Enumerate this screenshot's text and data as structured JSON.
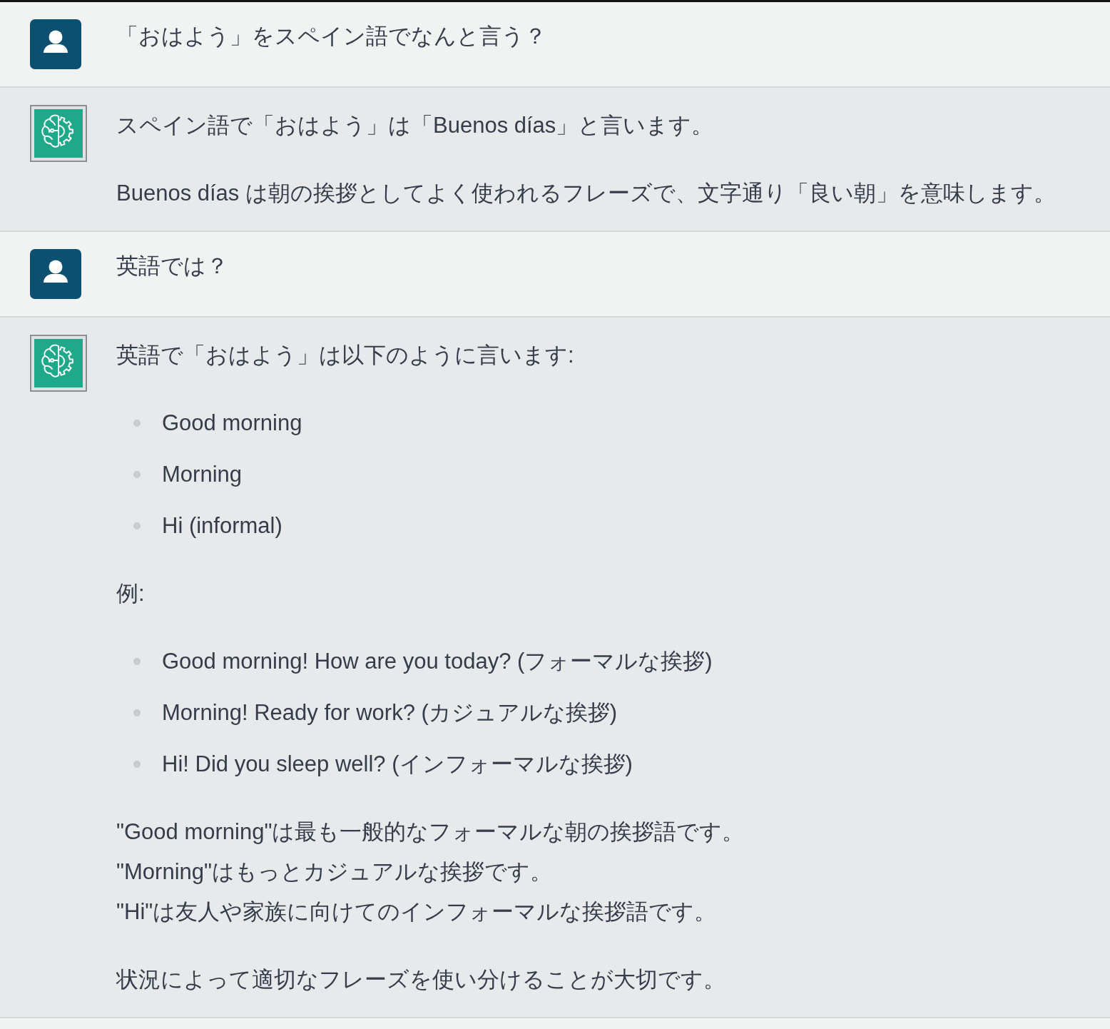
{
  "messages": [
    {
      "kind": "user",
      "blocks": [
        {
          "kind": "paragraph",
          "text": "「おはよう」をスペイン語でなんと言う？"
        }
      ]
    },
    {
      "kind": "assistant",
      "blocks": [
        {
          "kind": "paragraph",
          "text": "スペイン語で「おはよう」は「Buenos días」と言います。"
        },
        {
          "kind": "paragraph",
          "text": "Buenos días は朝の挨拶としてよく使われるフレーズで、文字通り「良い朝」を意味します。"
        }
      ]
    },
    {
      "kind": "user",
      "blocks": [
        {
          "kind": "paragraph",
          "text": "英語では？"
        }
      ]
    },
    {
      "kind": "assistant",
      "blocks": [
        {
          "kind": "paragraph",
          "text": "英語で「おはよう」は以下のように言います:"
        },
        {
          "kind": "list",
          "items": [
            "Good morning",
            "Morning",
            "Hi (informal)"
          ]
        },
        {
          "kind": "paragraph",
          "text": "例:"
        },
        {
          "kind": "list",
          "items": [
            "Good morning! How are you today? (フォーマルな挨拶)",
            "Morning! Ready for work? (カジュアルな挨拶)",
            "Hi! Did you sleep well? (インフォーマルな挨拶)"
          ]
        },
        {
          "kind": "lines",
          "lines": [
            "\"Good morning\"は最も一般的なフォーマルな朝の挨拶語です。",
            "\"Morning\"はもっとカジュアルな挨拶です。",
            "\"Hi\"は友人や家族に向けてのインフォーマルな挨拶語です。"
          ]
        },
        {
          "kind": "paragraph",
          "text": "状況によって適切なフレーズを使い分けることが大切です。"
        }
      ]
    }
  ]
}
